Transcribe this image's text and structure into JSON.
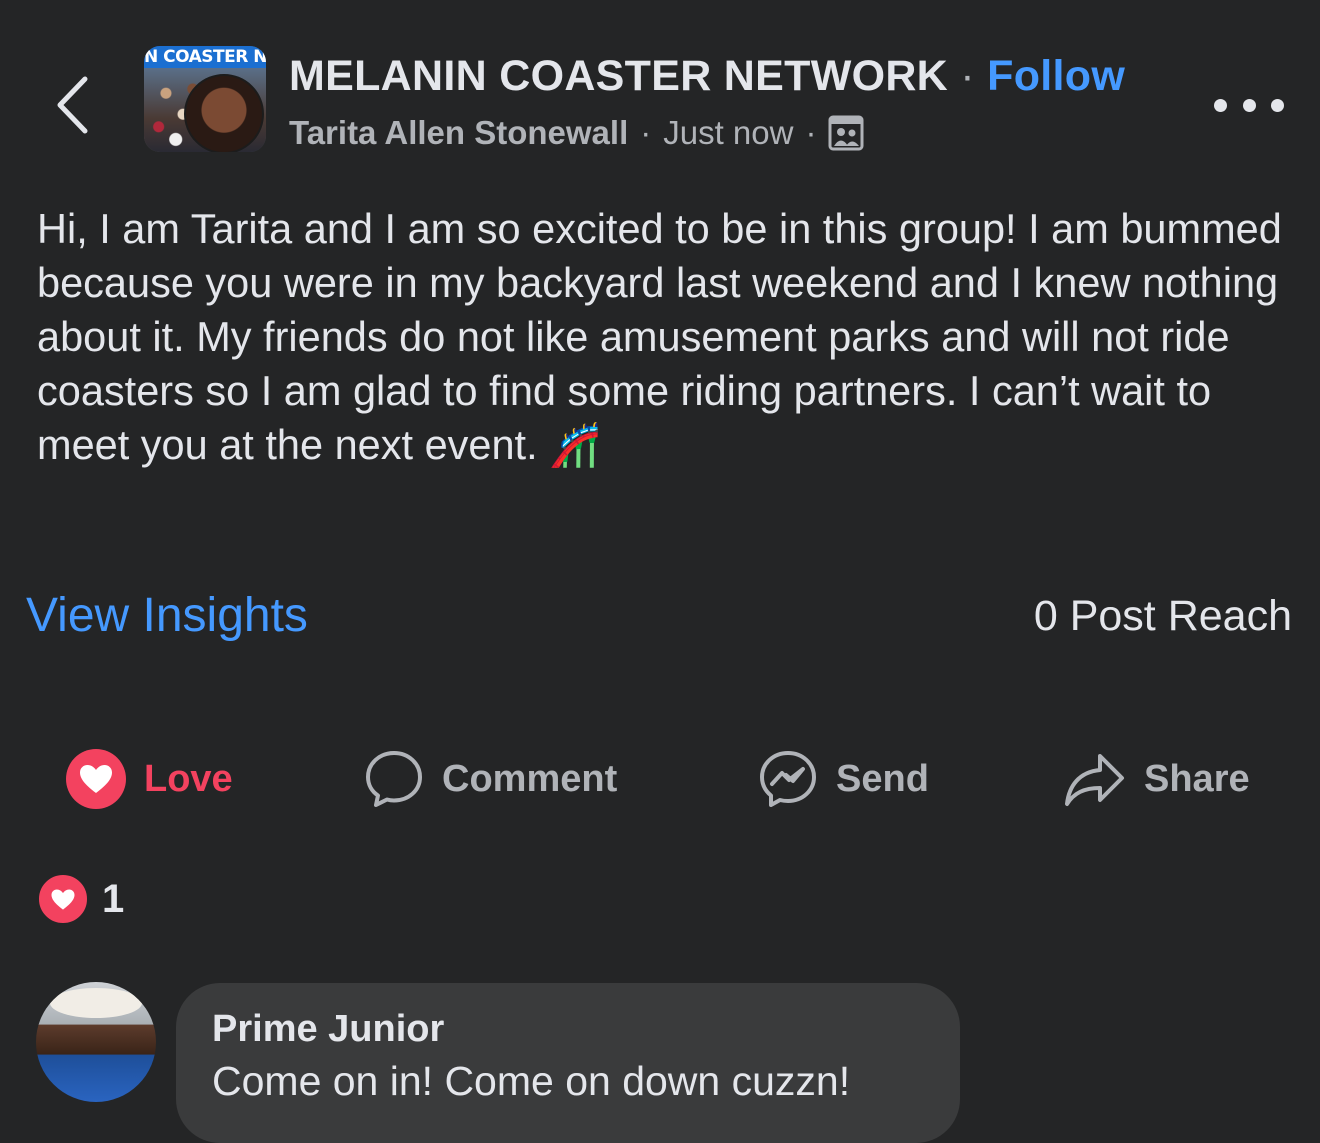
{
  "header": {
    "group_name": "MELANIN COASTER NETWORK",
    "separator": "·",
    "follow_label": "Follow",
    "author": "Tarita Allen Stonewall",
    "timestamp": "Just now",
    "avatar_banner_text": "N COASTER NE",
    "icons": {
      "back": "chevron-left-icon",
      "privacy": "group-members-icon",
      "more": "more-options-icon"
    }
  },
  "post": {
    "text": "Hi, I am Tarita and I am so excited to be in this group! I am bummed because you were in my backyard last weekend and I knew nothing about it. My friends do not like amusement parks and will not ride coasters so I am glad to find some riding partners. I can’t wait to meet you at the next event.",
    "emoji": "🎢"
  },
  "insights": {
    "view_label": "View Insights",
    "reach_label": "0 Post Reach"
  },
  "actions": {
    "love_label": "Love",
    "comment_label": "Comment",
    "send_label": "Send",
    "share_label": "Share"
  },
  "reactions": {
    "count": "1"
  },
  "comments": [
    {
      "author": "Prime Junior",
      "text": "Come on in! Come on down cuzzn!"
    }
  ],
  "colors": {
    "background": "#242526",
    "link_blue": "#4599ff",
    "love_red": "#f3425f",
    "bubble": "#3a3b3c",
    "muted_text": "#b0b3b8"
  }
}
